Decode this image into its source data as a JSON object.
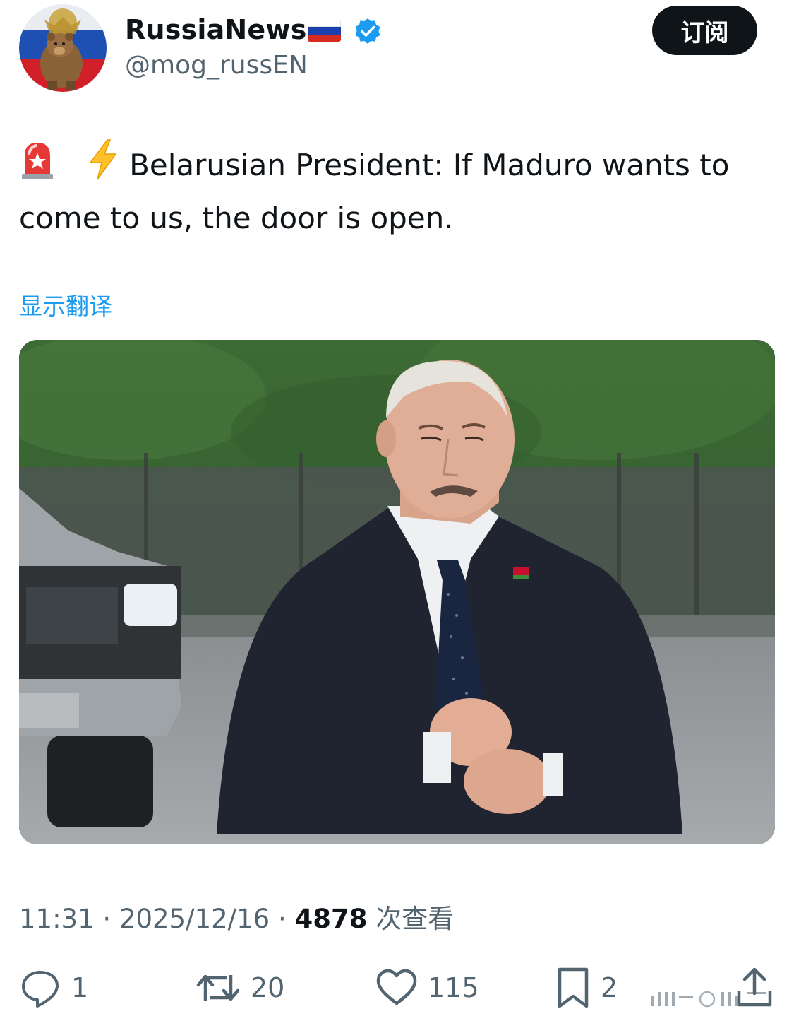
{
  "account": {
    "display_name": "RussiaNews",
    "handle": "@mog_russEN",
    "flag_icon": "russia-flag-icon",
    "verified_icon": "verified-badge-icon",
    "subscribe_label": "订阅"
  },
  "tweet": {
    "emoji_1": "🚨",
    "emoji_2": "⚡",
    "text": "Belarusian President: If Maduro wants to come to us, the door is open.",
    "translate_label": "显示翻译"
  },
  "meta": {
    "time": "11:31",
    "separator": "·",
    "date": "2025/12/16",
    "views_count": "4878",
    "views_label": "次查看"
  },
  "actions": {
    "reply_count": "1",
    "retweet_count": "20",
    "like_count": "115",
    "bookmark_count": "2"
  },
  "colors": {
    "accent": "#1d9bf0",
    "text_primary": "#0f1419",
    "text_secondary": "#536471"
  }
}
